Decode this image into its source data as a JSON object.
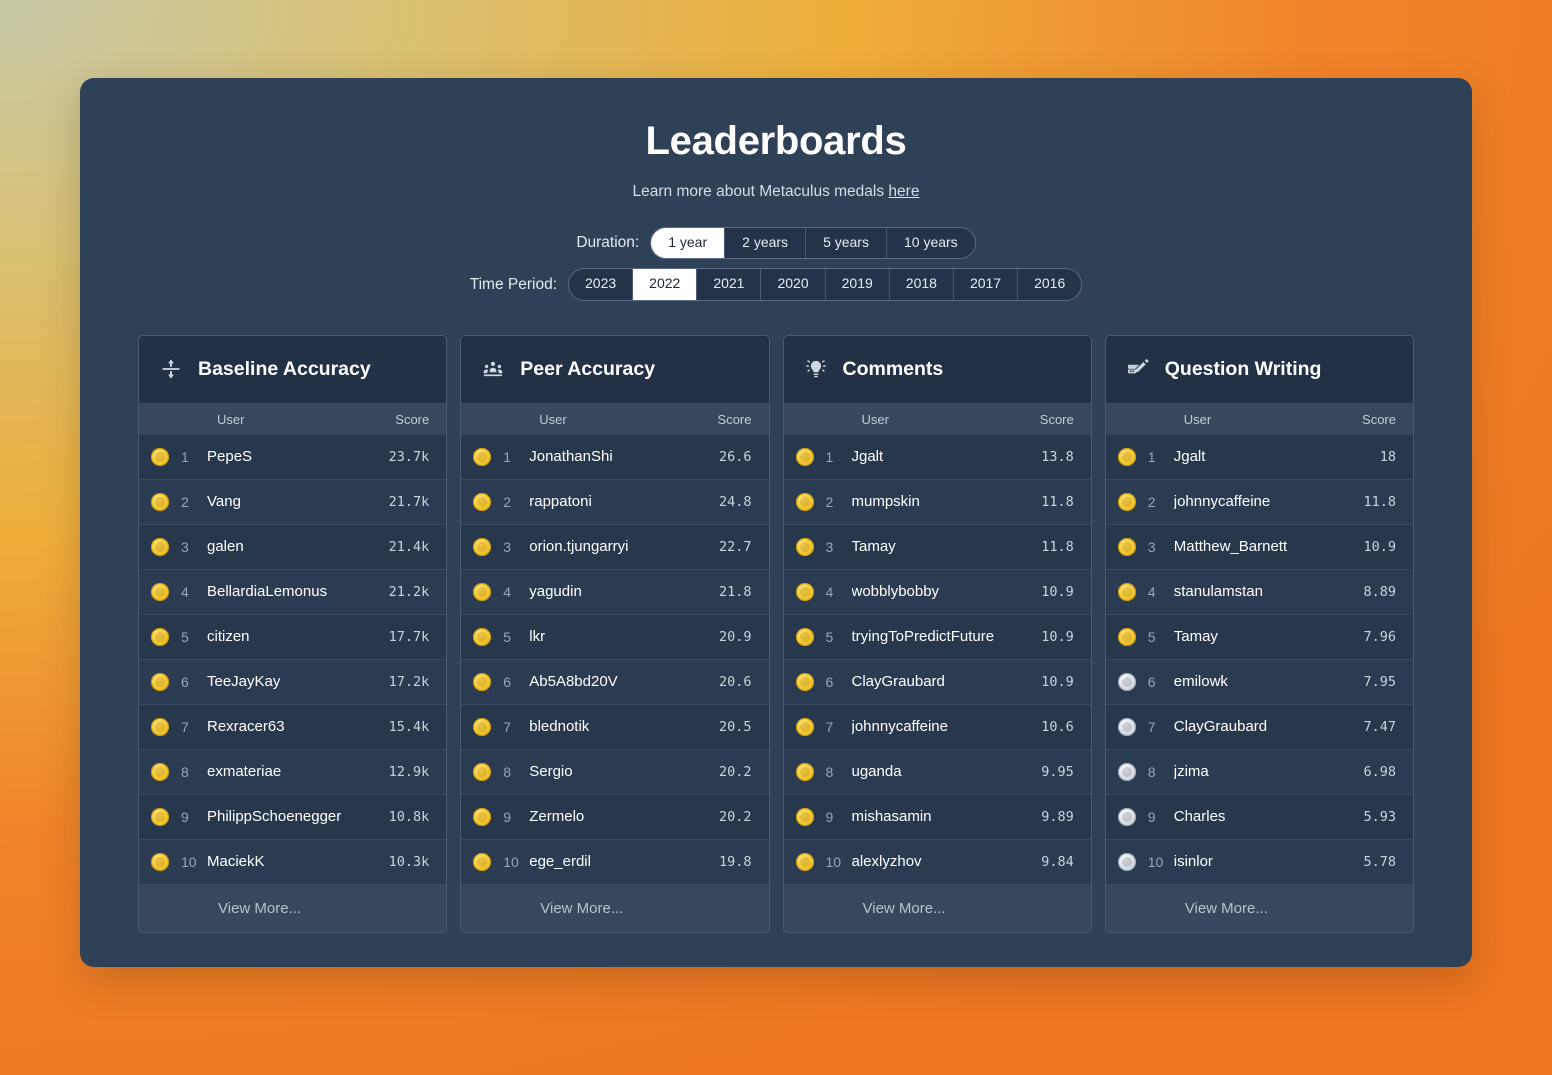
{
  "header": {
    "title": "Leaderboards",
    "subtitle_prefix": "Learn more about Metaculus medals ",
    "subtitle_link": "here"
  },
  "filters": {
    "duration": {
      "label": "Duration:",
      "options": [
        "1 year",
        "2 years",
        "5 years",
        "10 years"
      ],
      "selected": "1 year"
    },
    "time_period": {
      "label": "Time Period:",
      "options": [
        "2023",
        "2022",
        "2021",
        "2020",
        "2019",
        "2018",
        "2017",
        "2016"
      ],
      "selected": "2022"
    }
  },
  "columns": {
    "user": "User",
    "score": "Score"
  },
  "view_more_label": "View More...",
  "colors": {
    "panel_bg": "#2f4157",
    "board_bg": "#27374c",
    "board_header_bg": "#223146",
    "col_header_bg": "#37475d",
    "gold": "#f5cb3a",
    "silver": "#dfe4ea",
    "text_primary": "#ffffff",
    "text_muted": "#9aa6b5"
  },
  "boards": [
    {
      "title": "Baseline Accuracy",
      "icon": "baseline-arrows-icon",
      "rows": [
        {
          "rank": "1",
          "user": "PepeS",
          "score": "23.7k",
          "medal": "gold"
        },
        {
          "rank": "2",
          "user": "Vang",
          "score": "21.7k",
          "medal": "gold"
        },
        {
          "rank": "3",
          "user": "galen",
          "score": "21.4k",
          "medal": "gold"
        },
        {
          "rank": "4",
          "user": "BellardiaLemonus",
          "score": "21.2k",
          "medal": "gold"
        },
        {
          "rank": "5",
          "user": "citizen",
          "score": "17.7k",
          "medal": "gold"
        },
        {
          "rank": "6",
          "user": "TeeJayKay",
          "score": "17.2k",
          "medal": "gold"
        },
        {
          "rank": "7",
          "user": "Rexracer63",
          "score": "15.4k",
          "medal": "gold"
        },
        {
          "rank": "8",
          "user": "exmateriae",
          "score": "12.9k",
          "medal": "gold"
        },
        {
          "rank": "9",
          "user": "PhilippSchoenegger",
          "score": "10.8k",
          "medal": "gold"
        },
        {
          "rank": "10",
          "user": "MaciekK",
          "score": "10.3k",
          "medal": "gold"
        }
      ]
    },
    {
      "title": "Peer Accuracy",
      "icon": "people-group-icon",
      "rows": [
        {
          "rank": "1",
          "user": "JonathanShi",
          "score": "26.6",
          "medal": "gold"
        },
        {
          "rank": "2",
          "user": "rappatoni",
          "score": "24.8",
          "medal": "gold"
        },
        {
          "rank": "3",
          "user": "orion.tjungarryi",
          "score": "22.7",
          "medal": "gold"
        },
        {
          "rank": "4",
          "user": "yagudin",
          "score": "21.8",
          "medal": "gold"
        },
        {
          "rank": "5",
          "user": "lkr",
          "score": "20.9",
          "medal": "gold"
        },
        {
          "rank": "6",
          "user": "Ab5A8bd20V",
          "score": "20.6",
          "medal": "gold"
        },
        {
          "rank": "7",
          "user": "blednotik",
          "score": "20.5",
          "medal": "gold"
        },
        {
          "rank": "8",
          "user": "Sergio",
          "score": "20.2",
          "medal": "gold"
        },
        {
          "rank": "9",
          "user": "Zermelo",
          "score": "20.2",
          "medal": "gold"
        },
        {
          "rank": "10",
          "user": "ege_erdil",
          "score": "19.8",
          "medal": "gold"
        }
      ]
    },
    {
      "title": "Comments",
      "icon": "lightbulb-icon",
      "rows": [
        {
          "rank": "1",
          "user": "Jgalt",
          "score": "13.8",
          "medal": "gold"
        },
        {
          "rank": "2",
          "user": "mumpskin",
          "score": "11.8",
          "medal": "gold"
        },
        {
          "rank": "3",
          "user": "Tamay",
          "score": "11.8",
          "medal": "gold"
        },
        {
          "rank": "4",
          "user": "wobblybobby",
          "score": "10.9",
          "medal": "gold"
        },
        {
          "rank": "5",
          "user": "tryingToPredictFuture",
          "score": "10.9",
          "medal": "gold"
        },
        {
          "rank": "6",
          "user": "ClayGraubard",
          "score": "10.9",
          "medal": "gold"
        },
        {
          "rank": "7",
          "user": "johnnycaffeine",
          "score": "10.6",
          "medal": "gold"
        },
        {
          "rank": "8",
          "user": "uganda",
          "score": "9.95",
          "medal": "gold"
        },
        {
          "rank": "9",
          "user": "mishasamin",
          "score": "9.89",
          "medal": "gold"
        },
        {
          "rank": "10",
          "user": "alexlyzhov",
          "score": "9.84",
          "medal": "gold"
        }
      ]
    },
    {
      "title": "Question Writing",
      "icon": "pencil-edit-icon",
      "rows": [
        {
          "rank": "1",
          "user": "Jgalt",
          "score": "18",
          "medal": "gold"
        },
        {
          "rank": "2",
          "user": "johnnycaffeine",
          "score": "11.8",
          "medal": "gold"
        },
        {
          "rank": "3",
          "user": "Matthew_Barnett",
          "score": "10.9",
          "medal": "gold"
        },
        {
          "rank": "4",
          "user": "stanulamstan",
          "score": "8.89",
          "medal": "gold"
        },
        {
          "rank": "5",
          "user": "Tamay",
          "score": "7.96",
          "medal": "gold"
        },
        {
          "rank": "6",
          "user": "emilowk",
          "score": "7.95",
          "medal": "silver"
        },
        {
          "rank": "7",
          "user": "ClayGraubard",
          "score": "7.47",
          "medal": "silver"
        },
        {
          "rank": "8",
          "user": "jzima",
          "score": "6.98",
          "medal": "silver"
        },
        {
          "rank": "9",
          "user": "Charles",
          "score": "5.93",
          "medal": "silver"
        },
        {
          "rank": "10",
          "user": "isinlor",
          "score": "5.78",
          "medal": "silver"
        }
      ]
    }
  ]
}
